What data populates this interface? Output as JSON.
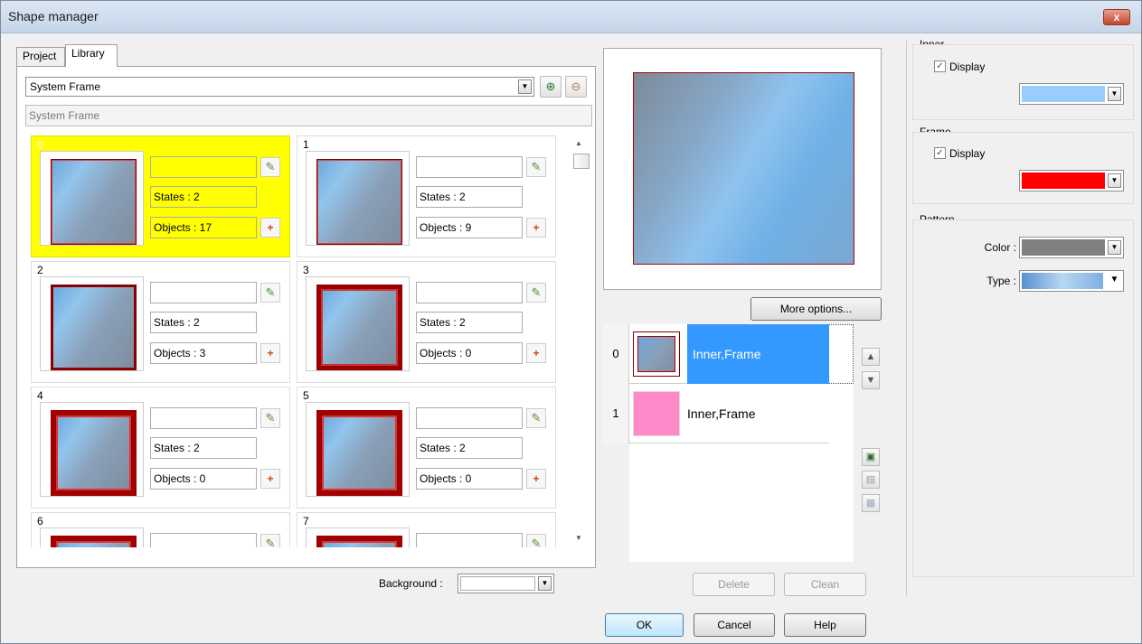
{
  "window": {
    "title": "Shape manager",
    "close_glyph": "x"
  },
  "tabs": [
    {
      "label": "Project"
    },
    {
      "label": "Library"
    }
  ],
  "library": {
    "dropdown_value": "System Frame",
    "description": "System Frame",
    "cells": [
      {
        "num": "0",
        "states": "States : 2",
        "objects": "Objects : 17"
      },
      {
        "num": "1",
        "states": "States : 2",
        "objects": "Objects : 9"
      },
      {
        "num": "2",
        "states": "States : 2",
        "objects": "Objects : 3"
      },
      {
        "num": "3",
        "states": "States : 2",
        "objects": "Objects : 0"
      },
      {
        "num": "4",
        "states": "States : 2",
        "objects": "Objects : 0"
      },
      {
        "num": "5",
        "states": "States : 2",
        "objects": "Objects : 0"
      },
      {
        "num": "6"
      },
      {
        "num": "7"
      }
    ],
    "background_label": "Background :"
  },
  "preview": {
    "more_options": "More options..."
  },
  "state_list": [
    {
      "index": "0",
      "label": "Inner,Frame",
      "selected": true
    },
    {
      "index": "1",
      "label": "Inner,Frame",
      "selected": false
    }
  ],
  "state_buttons": {
    "delete": "Delete",
    "clean": "Clean"
  },
  "right_panel": {
    "inner": {
      "title": "Inner",
      "display_label": "Display",
      "checked": true,
      "color": "#99ccff"
    },
    "frame": {
      "title": "Frame",
      "display_label": "Display",
      "checked": true,
      "color": "#ff0000"
    },
    "pattern": {
      "title": "Pattern",
      "color_label": "Color :",
      "color": "#808080",
      "type_label": "Type :"
    }
  },
  "dialog_buttons": {
    "ok": "OK",
    "cancel": "Cancel",
    "help": "Help"
  },
  "colors": {
    "selection_yellow": "#ffff00",
    "selected_state": "#3399ff",
    "state_pink": "#ff88c8"
  }
}
